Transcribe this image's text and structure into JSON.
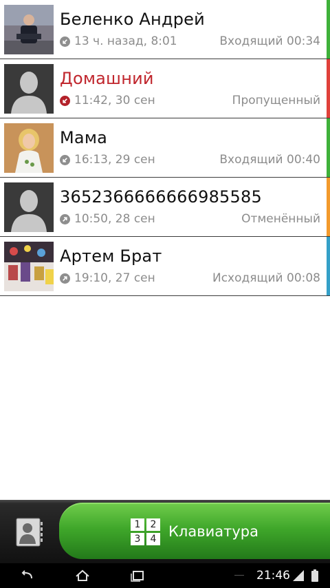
{
  "calls": [
    {
      "name": "Беленко Андрей",
      "time": "13 ч. назад, 8:01",
      "status": "Входящий 00:34",
      "type": "incoming",
      "stripe_color": "#3fb13a",
      "name_color": "#111111",
      "avatar": "photo-man"
    },
    {
      "name": "Домашний",
      "time": "11:42, 30 сен",
      "status": "Пропущенный",
      "type": "missed",
      "stripe_color": "#e0413a",
      "name_color": "#c0262d",
      "avatar": "placeholder"
    },
    {
      "name": "Мама",
      "time": "16:13, 29 сен",
      "status": "Входящий 00:40",
      "type": "incoming",
      "stripe_color": "#3fb13a",
      "name_color": "#111111",
      "avatar": "photo-woman"
    },
    {
      "name": "3652366666666985585",
      "time": "10:50, 28 сен",
      "status": "Отменённый",
      "type": "outgoing",
      "stripe_color": "#f39a2c",
      "name_color": "#111111",
      "avatar": "placeholder"
    },
    {
      "name": "Артем Брат",
      "time": "19:10, 27 сен",
      "status": "Исходящий 00:08",
      "type": "outgoing",
      "stripe_color": "#34a0c8",
      "name_color": "#111111",
      "avatar": "photo-group"
    }
  ],
  "bottom_bar": {
    "contacts_icon": "contacts-book-icon",
    "keypad_keys": [
      "1",
      "2",
      "3",
      "4"
    ],
    "keypad_label": "Клавиатура"
  },
  "system_bar": {
    "back_icon": "back-icon",
    "home_icon": "home-icon",
    "recents_icon": "recents-icon",
    "clock": "21:46",
    "signal_icon": "signal-icon",
    "battery_icon": "battery-icon"
  }
}
